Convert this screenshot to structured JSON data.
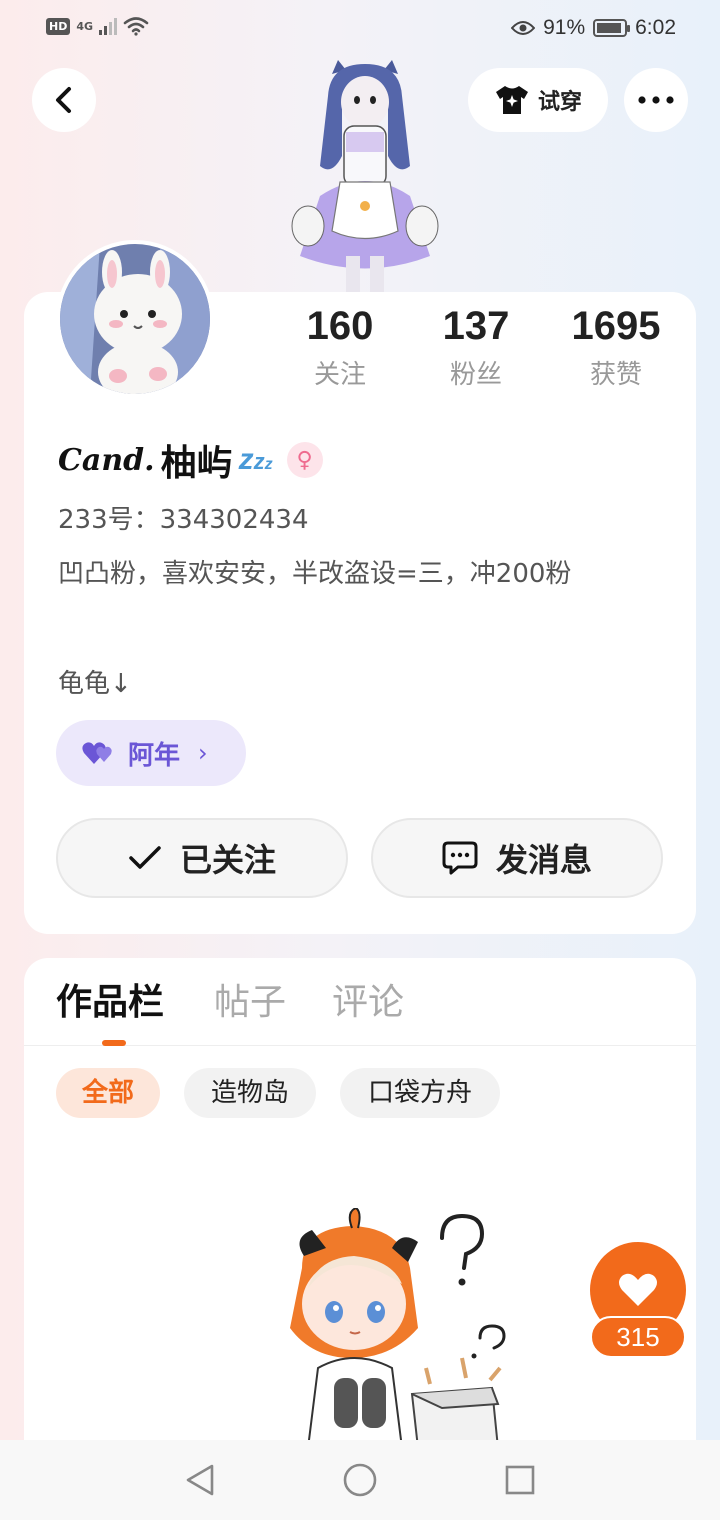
{
  "status_bar": {
    "hd": "HD",
    "network": "4G",
    "battery_percent": "91%",
    "battery_level": 0.91,
    "time": "6:02"
  },
  "header": {
    "back_icon": "chevron-left-icon",
    "tryon_label": "试穿",
    "tryon_icon": "tshirt-icon",
    "more_icon": "more-dots-icon"
  },
  "profile": {
    "stats": [
      {
        "value": "160",
        "label": "关注"
      },
      {
        "value": "137",
        "label": "粉丝"
      },
      {
        "value": "1695",
        "label": "获赞"
      }
    ],
    "nickname_prefix": "Cand.",
    "nickname": "柚屿",
    "nickname_suffix": "zzz",
    "gender_icon": "female-icon",
    "uid": "233号：334302434",
    "bio_line1": "凹凸粉，喜欢安安，半改盗设=三，冲200粉",
    "bio_line2": "龟龟↓",
    "club_tag": "阿年",
    "follow_button": "已关注",
    "message_button": "发消息"
  },
  "works": {
    "tabs": [
      "作品栏",
      "帖子",
      "评论"
    ],
    "active_tab": 0,
    "filters": [
      "全部",
      "造物岛",
      "口袋方舟"
    ],
    "active_filter": 0
  },
  "like_fab": {
    "count": "315",
    "icon": "heart-icon"
  },
  "nav": {
    "back": "nav-back-icon",
    "home": "nav-home-icon",
    "recents": "nav-recents-icon"
  },
  "colors": {
    "accent": "#f26a1b",
    "club_purple": "#6b56d6",
    "club_bg": "#ece8fb"
  }
}
